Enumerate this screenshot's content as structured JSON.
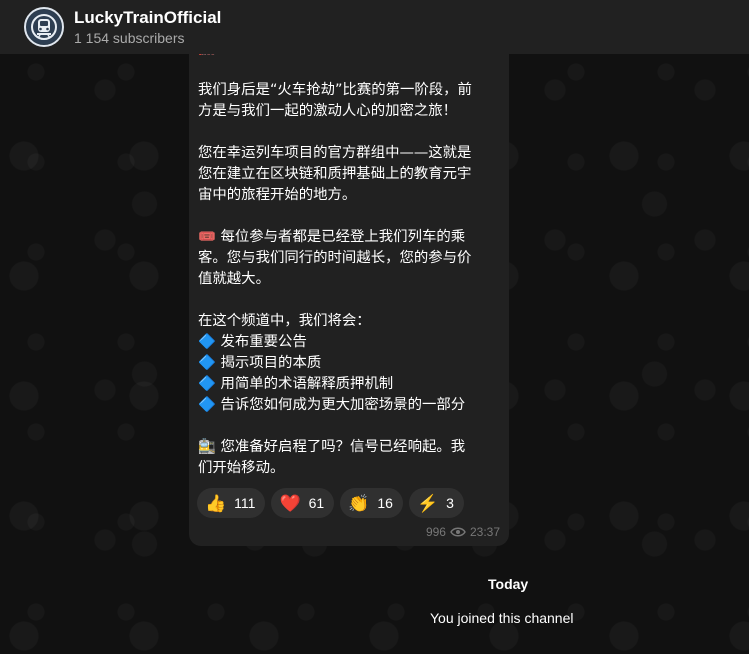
{
  "header": {
    "channel_name": "LuckyTrainOfficial",
    "subscribers": "1 154 subscribers"
  },
  "message": {
    "lines": [
      "🚂 欢迎登上幸运列车！",
      "",
      "我们身后是“火车抢劫”比赛的第一阶段，前",
      "方是与我们一起的激动人心的加密之旅！",
      "",
      "您在幸运列车项目的官方群组中——这就是",
      "您在建立在区块链和质押基础上的教育元宇",
      "宙中的旅程开始的地方。",
      "",
      "🎟️ 每位参与者都是已经登上我们列车的乘",
      "客。您与我们同行的时间越长，您的参与价",
      "值就越大。",
      "",
      "在这个频道中，我们将会：",
      "🔷 发布重要公告",
      "🔷 揭示项目的本质",
      "🔷 用简单的术语解释质押机制",
      "🔷 告诉您如何成为更大加密场景的一部分",
      "",
      "🚉 您准备好启程了吗？信号已经响起。我",
      "们开始移动。"
    ],
    "reactions": [
      {
        "emoji": "👍",
        "count": "111"
      },
      {
        "emoji": "❤️",
        "count": "61"
      },
      {
        "emoji": "👏",
        "count": "16"
      },
      {
        "emoji": "⚡",
        "count": "3"
      }
    ],
    "views": "996",
    "time": "23:37"
  },
  "date_separator": "Today",
  "service_message": "You joined this channel",
  "colors": {
    "header_bg": "#212121",
    "bubble_bg": "#212121",
    "reaction_bg": "#303030",
    "secondary_text": "#aaaaaa"
  }
}
